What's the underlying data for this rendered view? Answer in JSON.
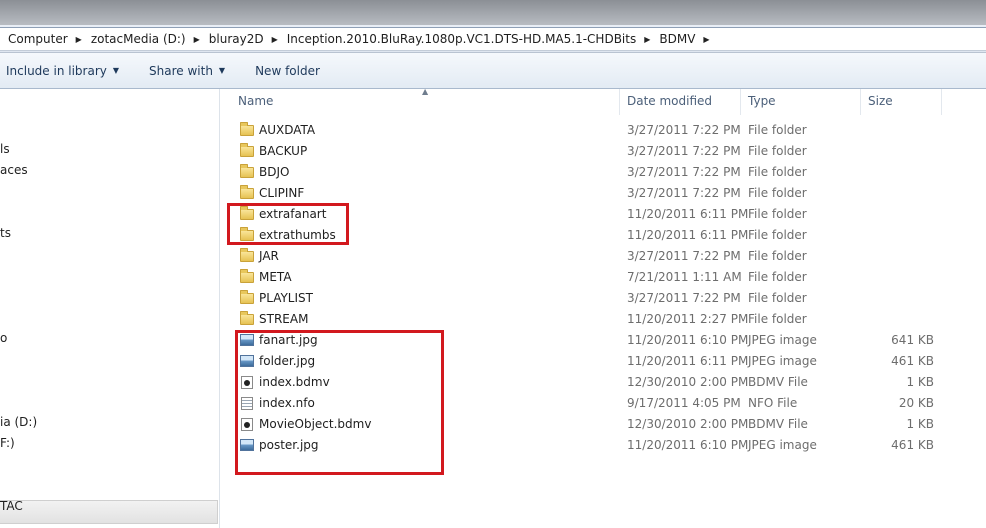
{
  "breadcrumb": [
    "Computer",
    "zotacMedia (D:)",
    "bluray2D",
    "Inception.2010.BluRay.1080p.VC1.DTS-HD.MA5.1-CHDBits",
    "BDMV"
  ],
  "toolbar": {
    "include_label": "Include in library",
    "share_label": "Share with",
    "new_folder_label": "New folder"
  },
  "nav": {
    "items": [
      "ls",
      "aces",
      "ts",
      "o",
      "ia (D:)",
      "F:)",
      "TAC"
    ]
  },
  "columns": {
    "name": "Name",
    "date": "Date modified",
    "type": "Type",
    "size": "Size"
  },
  "files": [
    {
      "icon": "folder-icon",
      "name": "AUXDATA",
      "date": "3/27/2011 7:22 PM",
      "type": "File folder",
      "size": ""
    },
    {
      "icon": "folder-icon",
      "name": "BACKUP",
      "date": "3/27/2011 7:22 PM",
      "type": "File folder",
      "size": ""
    },
    {
      "icon": "folder-icon",
      "name": "BDJO",
      "date": "3/27/2011 7:22 PM",
      "type": "File folder",
      "size": ""
    },
    {
      "icon": "folder-icon",
      "name": "CLIPINF",
      "date": "3/27/2011 7:22 PM",
      "type": "File folder",
      "size": ""
    },
    {
      "icon": "folder-icon",
      "name": "extrafanart",
      "date": "11/20/2011 6:11 PM",
      "type": "File folder",
      "size": ""
    },
    {
      "icon": "folder-icon",
      "name": "extrathumbs",
      "date": "11/20/2011 6:11 PM",
      "type": "File folder",
      "size": ""
    },
    {
      "icon": "folder-icon",
      "name": "JAR",
      "date": "3/27/2011 7:22 PM",
      "type": "File folder",
      "size": ""
    },
    {
      "icon": "folder-icon",
      "name": "META",
      "date": "7/21/2011 1:11 AM",
      "type": "File folder",
      "size": ""
    },
    {
      "icon": "folder-icon",
      "name": "PLAYLIST",
      "date": "3/27/2011 7:22 PM",
      "type": "File folder",
      "size": ""
    },
    {
      "icon": "folder-icon",
      "name": "STREAM",
      "date": "11/20/2011 2:27 PM",
      "type": "File folder",
      "size": ""
    },
    {
      "icon": "jpeg-image-icon",
      "name": "fanart.jpg",
      "date": "11/20/2011 6:10 PM",
      "type": "JPEG image",
      "size": "641 KB"
    },
    {
      "icon": "jpeg-image-icon",
      "name": "folder.jpg",
      "date": "11/20/2011 6:11 PM",
      "type": "JPEG image",
      "size": "461 KB"
    },
    {
      "icon": "bdmv-file-icon",
      "name": "index.bdmv",
      "date": "12/30/2010 2:00 PM",
      "type": "BDMV File",
      "size": "1 KB"
    },
    {
      "icon": "nfo-file-icon",
      "name": "index.nfo",
      "date": "9/17/2011 4:05 PM",
      "type": "NFO File",
      "size": "20 KB"
    },
    {
      "icon": "bdmv-file-icon",
      "name": "MovieObject.bdmv",
      "date": "12/30/2010 2:00 PM",
      "type": "BDMV File",
      "size": "1 KB"
    },
    {
      "icon": "jpeg-image-icon",
      "name": "poster.jpg",
      "date": "11/20/2011 6:10 PM",
      "type": "JPEG image",
      "size": "461 KB"
    }
  ],
  "colors": {
    "annotation_red": "#d2181e",
    "toolbar_text": "#1e395b",
    "header_text": "#4c607a"
  }
}
